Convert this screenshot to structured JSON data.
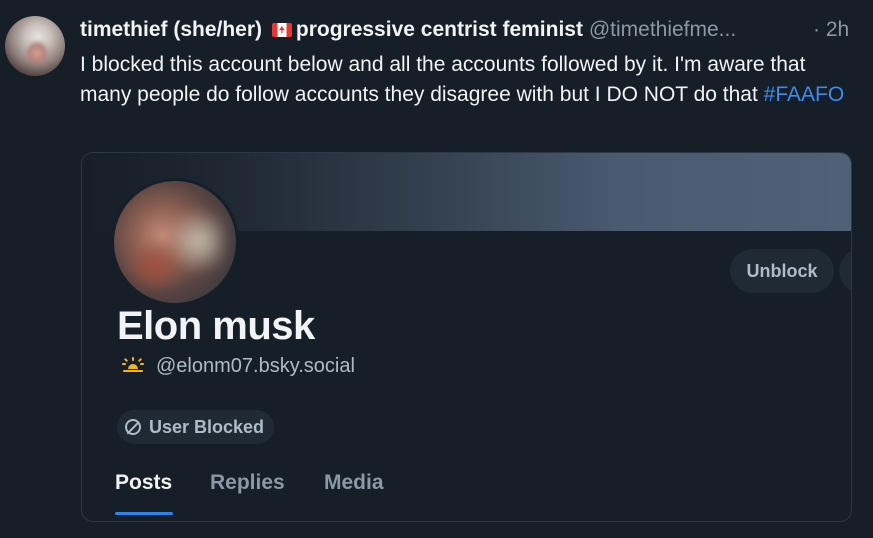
{
  "post": {
    "display_name": "timethief (she/her)",
    "bio_tag": "progressive centrist feminist",
    "handle": "@timethiefme...",
    "separator": "·",
    "timestamp": "2h",
    "text": " I blocked this account below and all the accounts followed by it. I'm aware that many people do follow accounts they disagree with but I DO NOT do that ",
    "hashtag": "#FAAFO",
    "flag_icon": "canada-flag-icon"
  },
  "embed": {
    "profile_name": "Elon musk",
    "handle": "@elonm07.bsky.social",
    "handle_icon": "sunrise-icon",
    "unblock_label": "Unblock",
    "blocked_badge": "User Blocked",
    "tabs": [
      {
        "label": "Posts",
        "active": true
      },
      {
        "label": "Replies",
        "active": false
      },
      {
        "label": "Media",
        "active": false
      }
    ]
  },
  "colors": {
    "background": "#161e27",
    "accent": "#2f84e6",
    "hashtag": "#3b8cf0",
    "muted_text": "#8b98a5",
    "sun_icon": "#f5b51f"
  }
}
